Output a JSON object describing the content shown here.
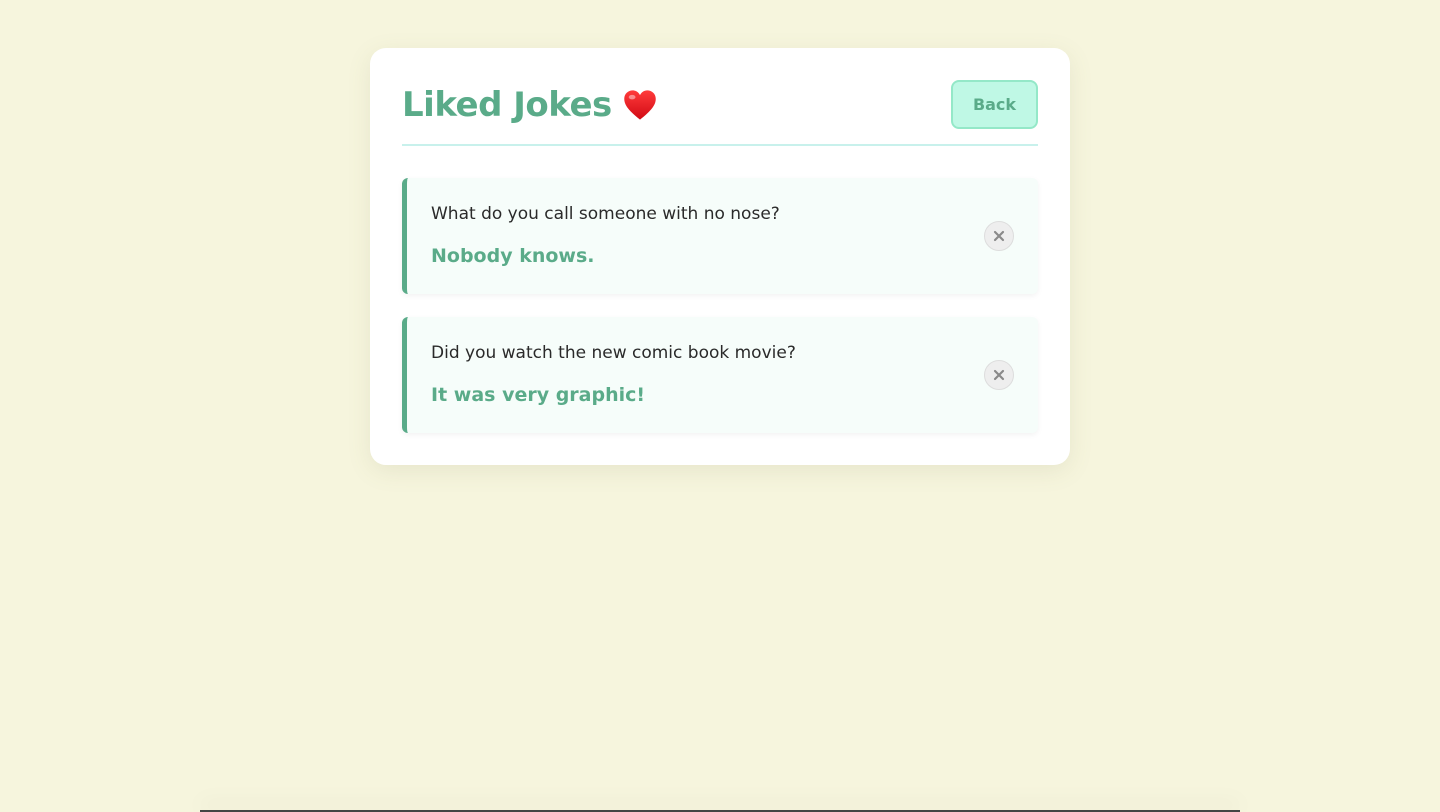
{
  "page": {
    "title": "Liked Jokes",
    "back_label": "Back"
  },
  "jokes": [
    {
      "setup": "What do you call someone with no nose?",
      "punchline": "Nobody knows."
    },
    {
      "setup": "Did you watch the new comic book movie?",
      "punchline": "It was very graphic!"
    }
  ],
  "icons": {
    "title_icon": "heart-icon",
    "remove_icon": "close-icon"
  },
  "colors": {
    "background": "#f6f5dd",
    "accent": "#5aab89",
    "button_bg": "#bff8e5",
    "divider": "#c8f1ec",
    "heart": "#e8141b"
  }
}
